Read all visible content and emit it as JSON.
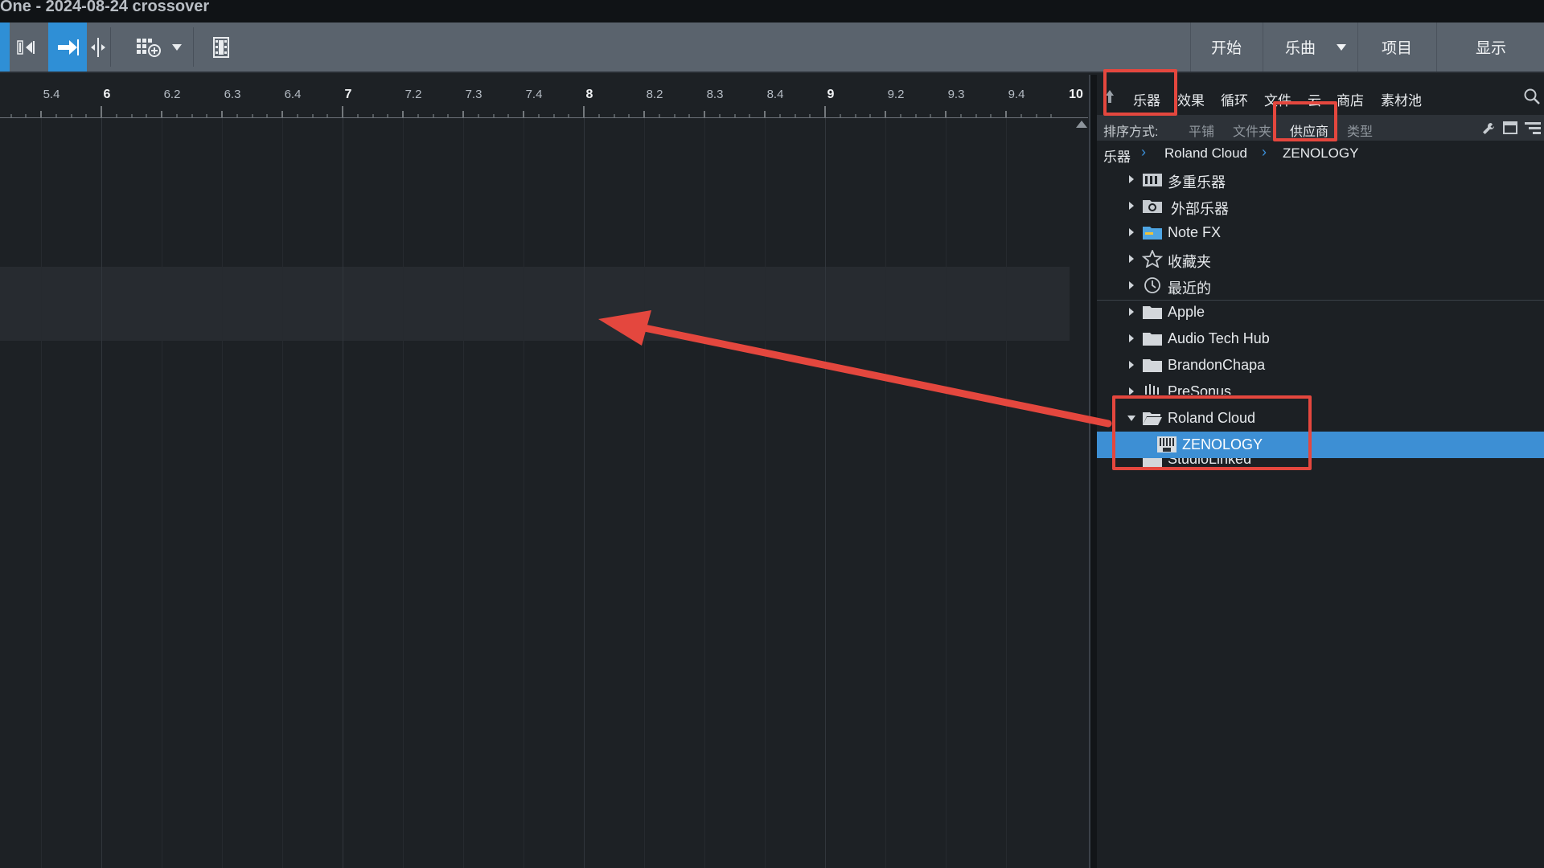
{
  "window": {
    "title": "One - 2024-08-24 crossover"
  },
  "toolbar": {
    "nav": {
      "start": "开始",
      "song": "乐曲",
      "project": "项目",
      "show": "显示"
    }
  },
  "ruler": {
    "ticks": [
      "5.4",
      "6",
      "6.2",
      "6.3",
      "6.4",
      "7",
      "7.2",
      "7.3",
      "7.4",
      "8",
      "8.2",
      "8.3",
      "8.4",
      "9",
      "9.2",
      "9.3",
      "9.4",
      "10"
    ]
  },
  "browser": {
    "tabs": {
      "instruments": "乐器",
      "effects": "效果",
      "loops": "循环",
      "files": "文件",
      "cloud": "云",
      "shop": "商店",
      "pool": "素材池"
    },
    "sort": {
      "label": "排序方式:",
      "flat": "平铺",
      "folder": "文件夹",
      "vendor": "供应商",
      "type": "类型"
    },
    "breadcrumb": {
      "root": "乐器",
      "vendor": "Roland Cloud",
      "item": "ZENOLOGY"
    },
    "tree": {
      "multi": "多重乐器",
      "external": "外部乐器",
      "notefx": "Note FX",
      "favorites": "收藏夹",
      "recent": "最近的",
      "apple": "Apple",
      "audiotechhub": "Audio Tech Hub",
      "brandonchapa": "BrandonChapa",
      "presonus": "PreSonus",
      "roland": "Roland Cloud",
      "zenology": "ZENOLOGY",
      "studiolinked": "StudioLinked"
    }
  },
  "colors": {
    "accent": "#3d8fd4",
    "highlight": "#e4473e"
  }
}
